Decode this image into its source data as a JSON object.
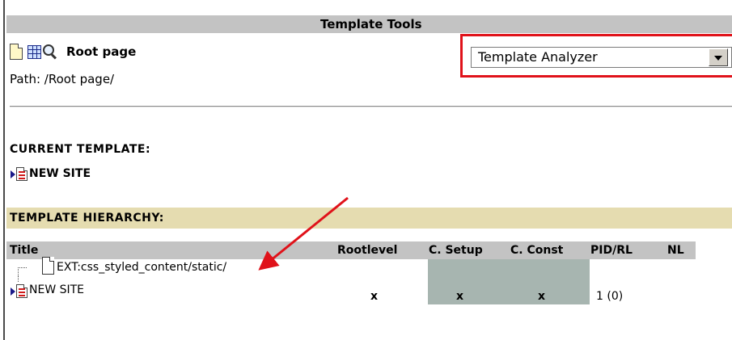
{
  "header": {
    "title": "Template Tools"
  },
  "page": {
    "title": "Root page",
    "path": "Path: /Root page/"
  },
  "tool_select": {
    "selected": "Template Analyzer"
  },
  "current_template": {
    "label": "CURRENT TEMPLATE:",
    "name": "NEW SITE"
  },
  "hierarchy": {
    "label": "TEMPLATE HIERARCHY:",
    "columns": {
      "title": "Title",
      "rootlevel": "Rootlevel",
      "setup": "C. Setup",
      "const": "C. Const",
      "pid": "PID/RL",
      "nl": "NL"
    },
    "rows": [
      {
        "title": "EXT:css_styled_content/static/",
        "rootlevel": "",
        "setup": "",
        "const": "",
        "pid": ""
      },
      {
        "title": "NEW SITE",
        "rootlevel": "x",
        "setup": "x",
        "const": "x",
        "pid": "1 (0)"
      }
    ]
  },
  "colors": {
    "highlight": "#e0121a",
    "header_bg": "#c3c3c3",
    "section_bg": "#e5dcb0",
    "cell_gray": "#a7b5b0"
  },
  "icons": [
    "page-icon",
    "table-view-icon",
    "magnifier-icon",
    "template-icon",
    "blank-page-icon",
    "expand-arrow-icon",
    "dropdown-arrow-icon"
  ]
}
